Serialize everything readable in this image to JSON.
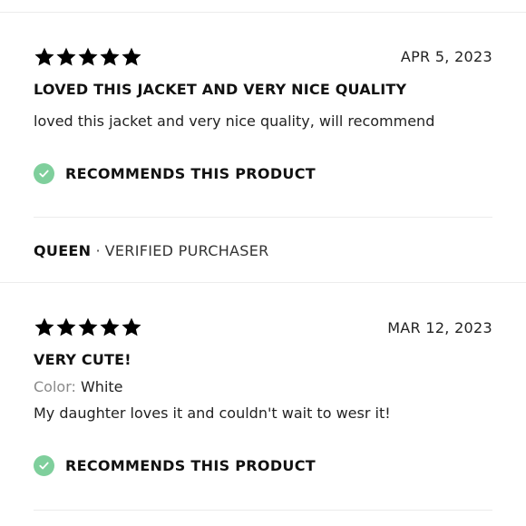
{
  "reviews": [
    {
      "rating": 5,
      "date": "APR 5, 2023",
      "title": "LOVED THIS JACKET AND VERY NICE QUALITY",
      "body": "loved this jacket and very nice quality, will recommend",
      "recommends_label": "RECOMMENDS THIS PRODUCT",
      "reviewer_name": "QUEEN",
      "separator": "·",
      "reviewer_status": "VERIFIED PURCHASER"
    },
    {
      "rating": 5,
      "date": "MAR 12, 2023",
      "title": "VERY CUTE!",
      "color_label": "Color:",
      "color_value": "White",
      "body": "My daughter loves it and couldn't wait to wesr it!",
      "recommends_label": "RECOMMENDS THIS PRODUCT"
    }
  ],
  "colors": {
    "star": "#000000",
    "check_badge": "#7fcf9c",
    "divider": "#ececec"
  },
  "icons": {
    "star": "star-icon",
    "check": "check-icon"
  }
}
